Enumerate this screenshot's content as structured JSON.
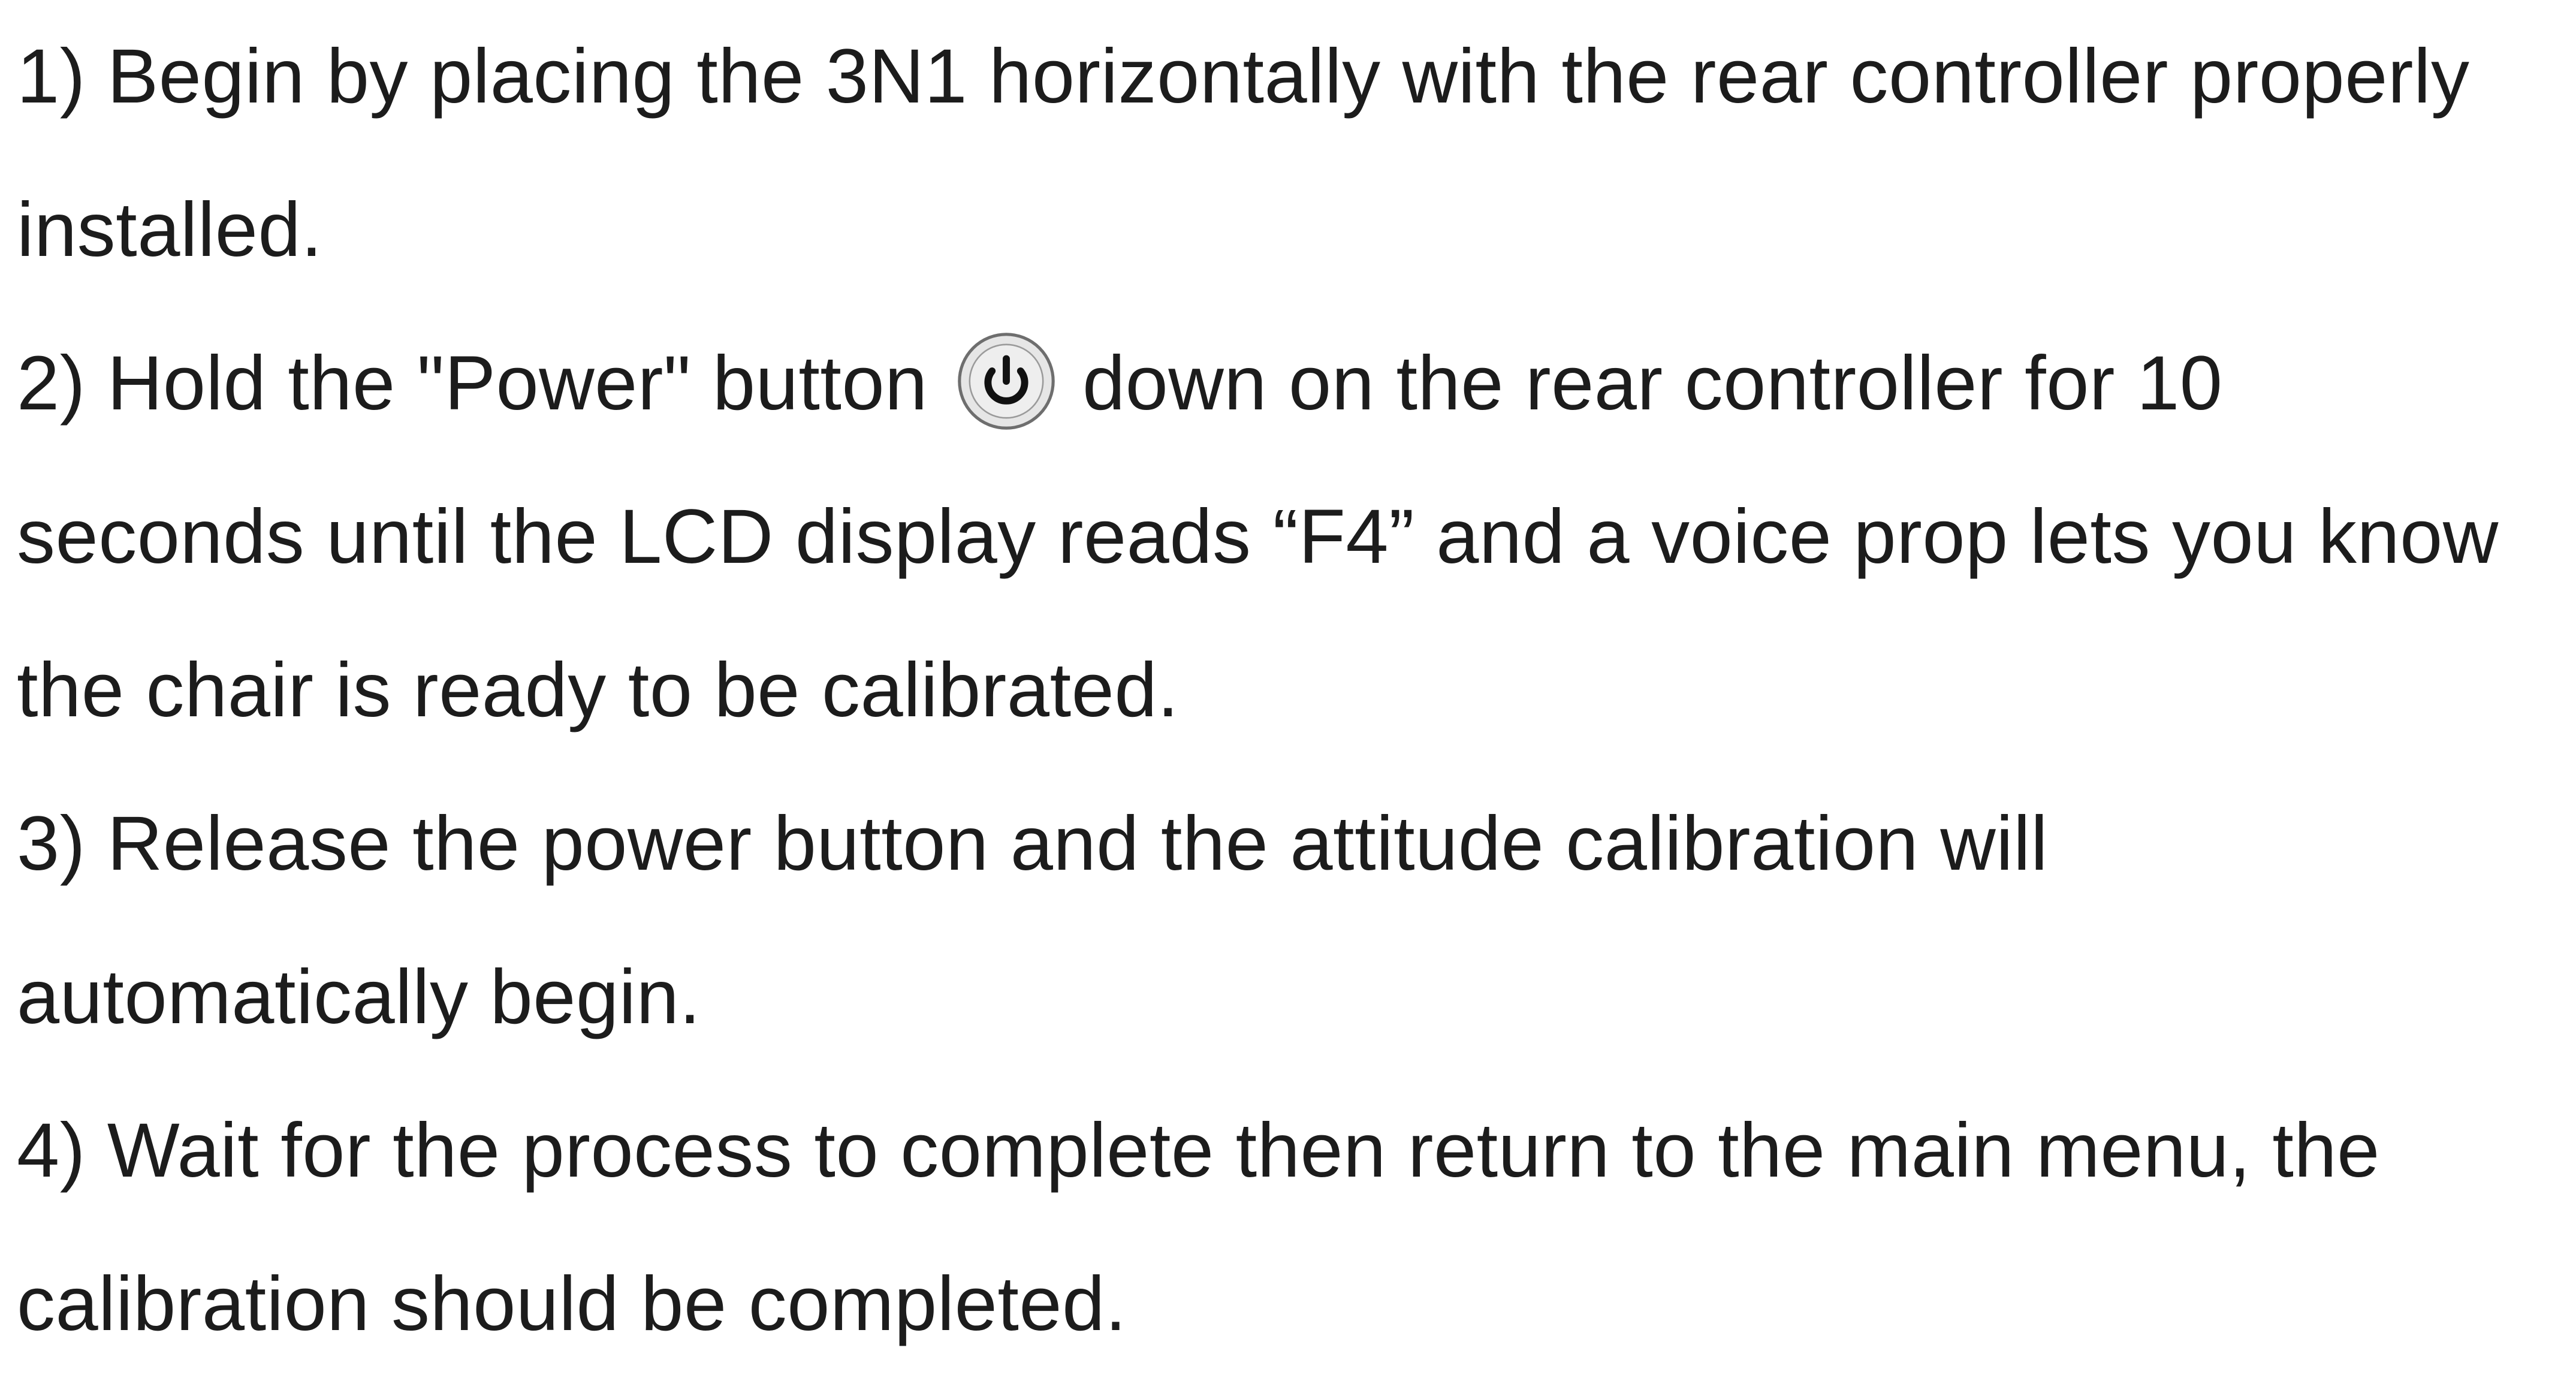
{
  "steps": [
    {
      "line1": "1) Begin by placing the 3N1 horizontally with the rear controller properly",
      "line2": "installed."
    },
    {
      "line1_before_icon": "2) Hold the \"Power\" button",
      "icon": "power-icon",
      "line1_after_icon": "down on the rear controller for 10",
      "line2": "seconds until the LCD display reads “F4” and a voice prop lets you know",
      "line3": "the chair is ready to be calibrated."
    },
    {
      "line1": "3) Release the power button and the attitude calibration will",
      "line2": "automatically begin."
    },
    {
      "line1": "4) Wait for the process to complete then return to the main menu, the",
      "line2": "calibration should be completed."
    }
  ],
  "colors": {
    "text": "#1c1c1c",
    "icon_ring": "#6e6e6e",
    "icon_fill": "#e6e6e6",
    "icon_glyph": "#111111"
  }
}
